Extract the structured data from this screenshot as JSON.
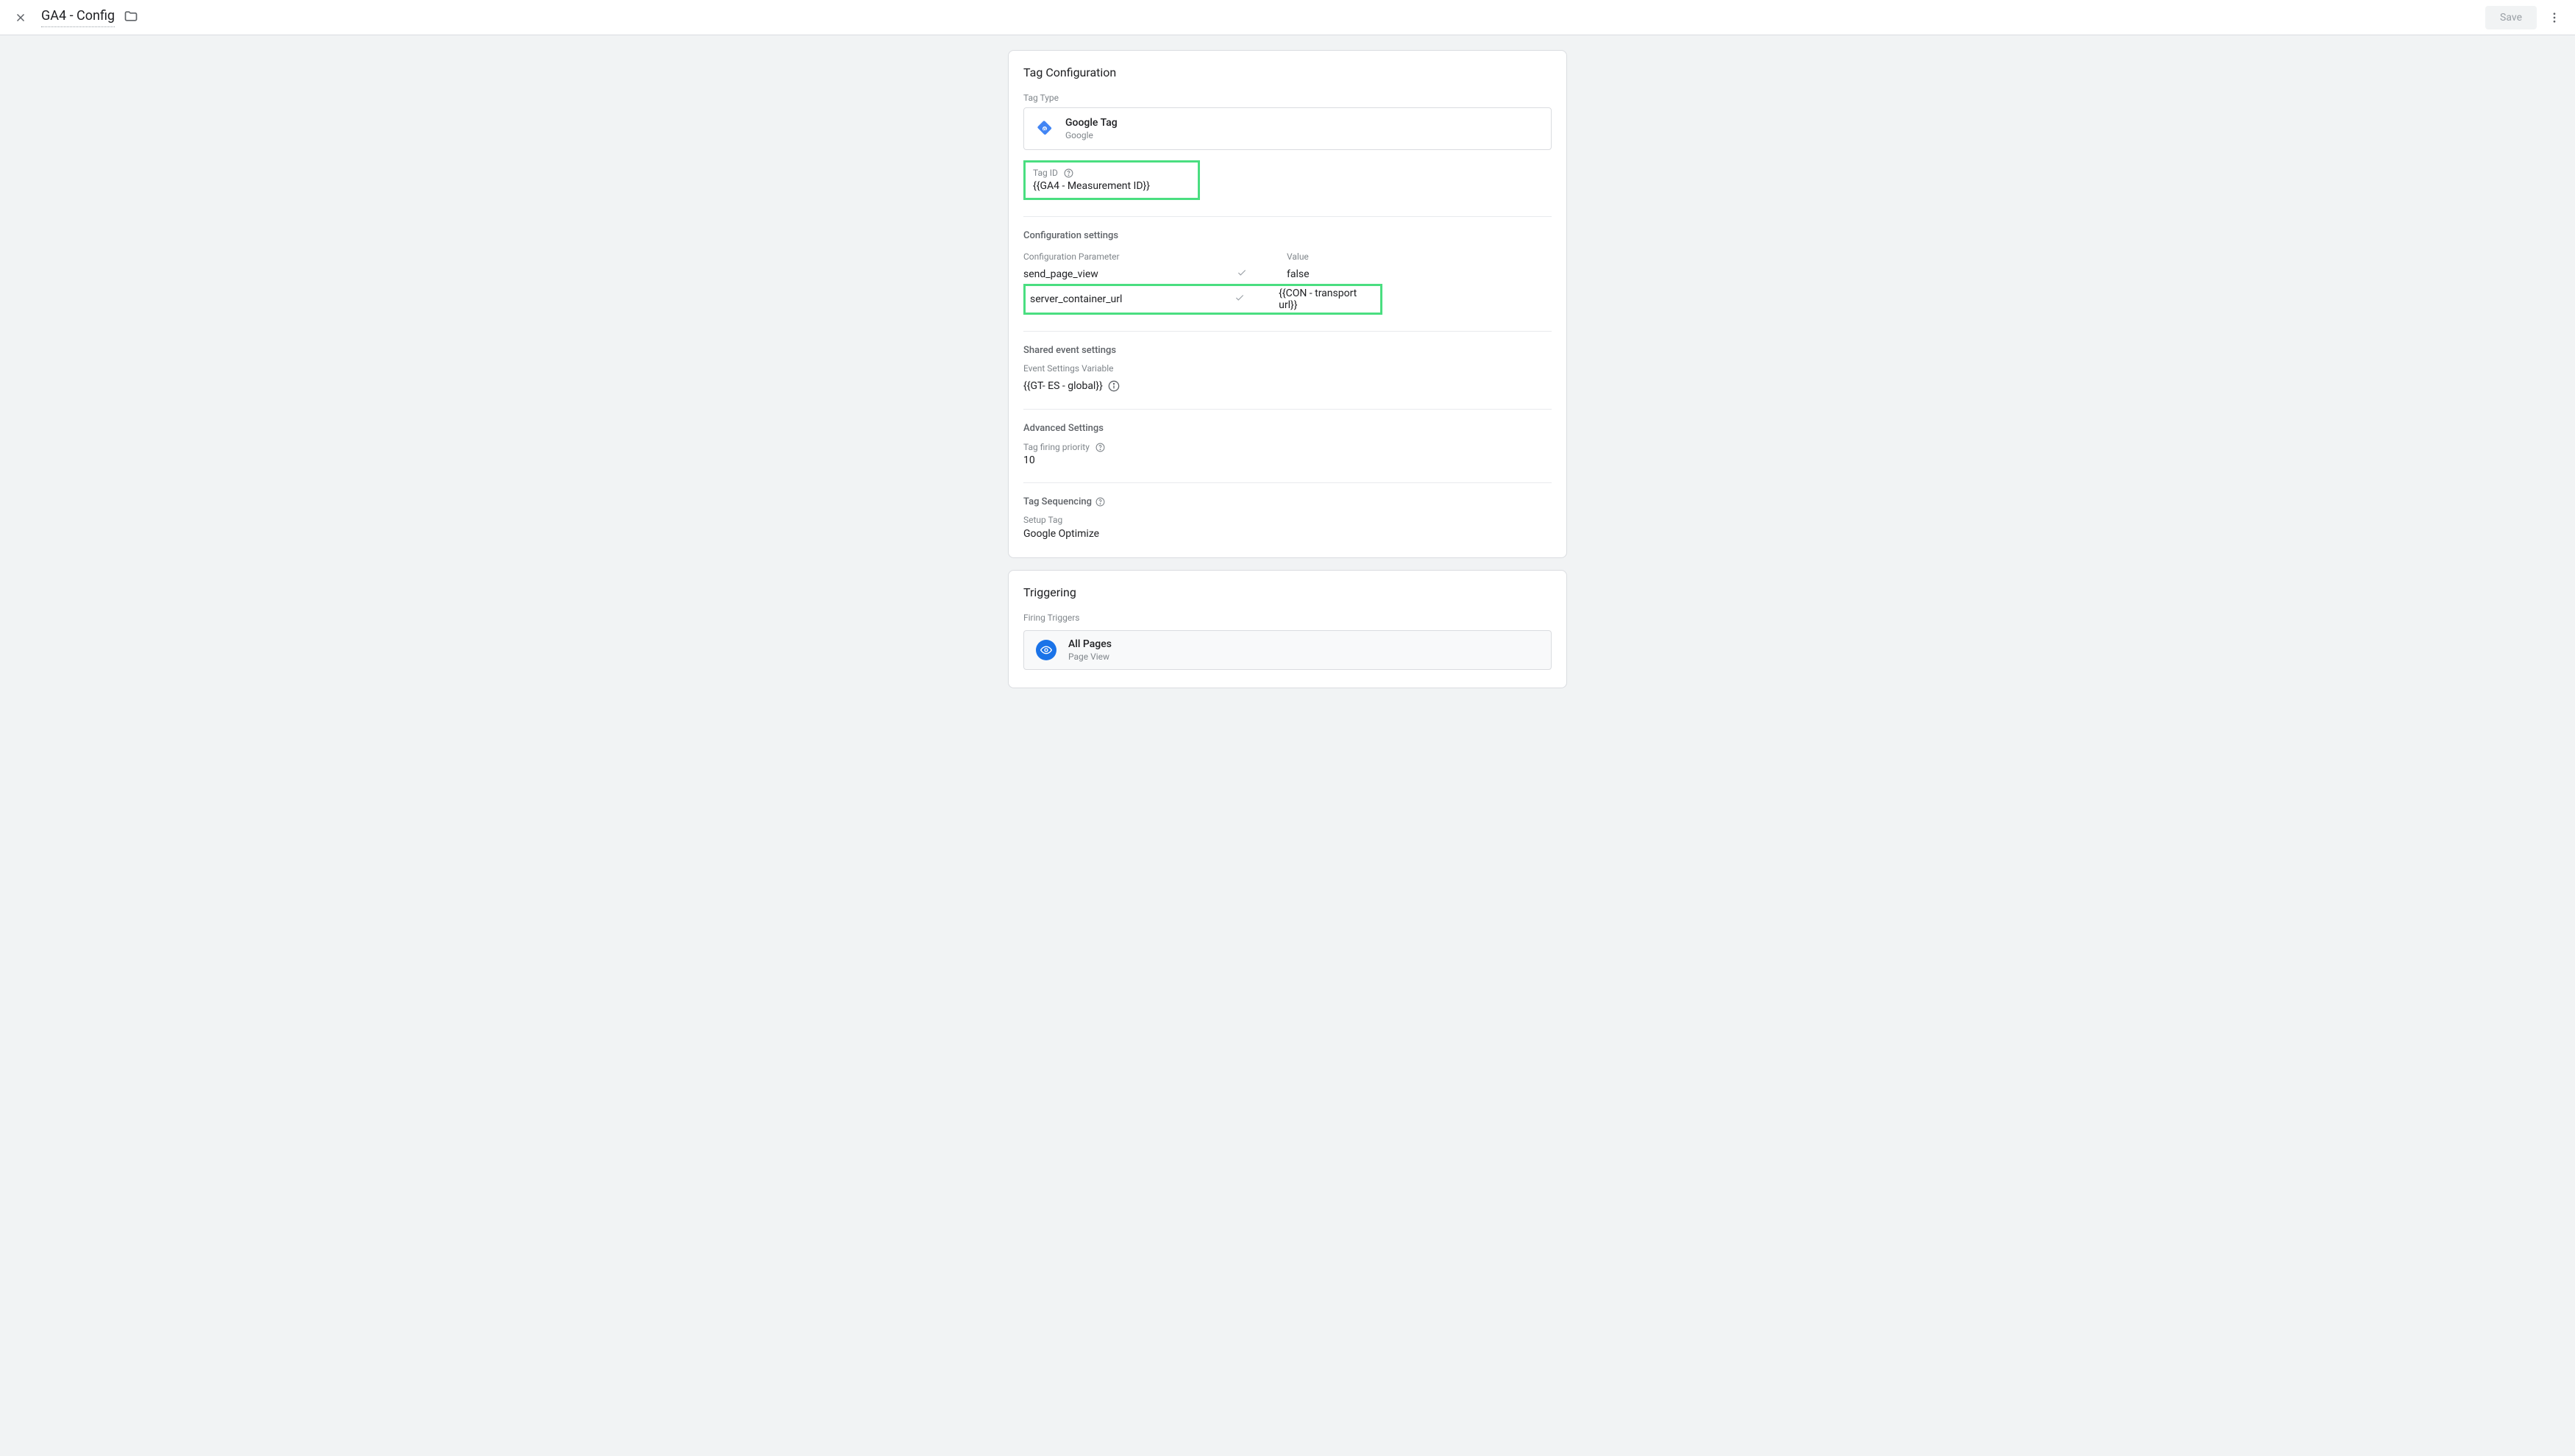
{
  "header": {
    "title": "GA4 - Config",
    "save_label": "Save"
  },
  "tagConfig": {
    "card_title": "Tag Configuration",
    "tagTypeLabel": "Tag Type",
    "tagType": {
      "name": "Google Tag",
      "vendor": "Google"
    },
    "tagId": {
      "label": "Tag ID",
      "value": "{{GA4 - Measurement ID}}"
    },
    "configSettings": {
      "title": "Configuration settings",
      "col_param": "Configuration Parameter",
      "col_value": "Value",
      "rows": [
        {
          "param": "send_page_view",
          "value": "false"
        },
        {
          "param": "server_container_url",
          "value": "{{CON - transport url}}"
        }
      ]
    },
    "sharedEvent": {
      "title": "Shared event settings",
      "label": "Event Settings Variable",
      "value": "{{GT- ES - global}}"
    },
    "advanced": {
      "title": "Advanced Settings",
      "priorityLabel": "Tag firing priority",
      "priorityValue": "10"
    },
    "sequencing": {
      "title": "Tag Sequencing",
      "setupLabel": "Setup Tag",
      "setupValue": "Google Optimize"
    }
  },
  "triggering": {
    "card_title": "Triggering",
    "label": "Firing Triggers",
    "trigger": {
      "name": "All Pages",
      "type": "Page View"
    }
  }
}
